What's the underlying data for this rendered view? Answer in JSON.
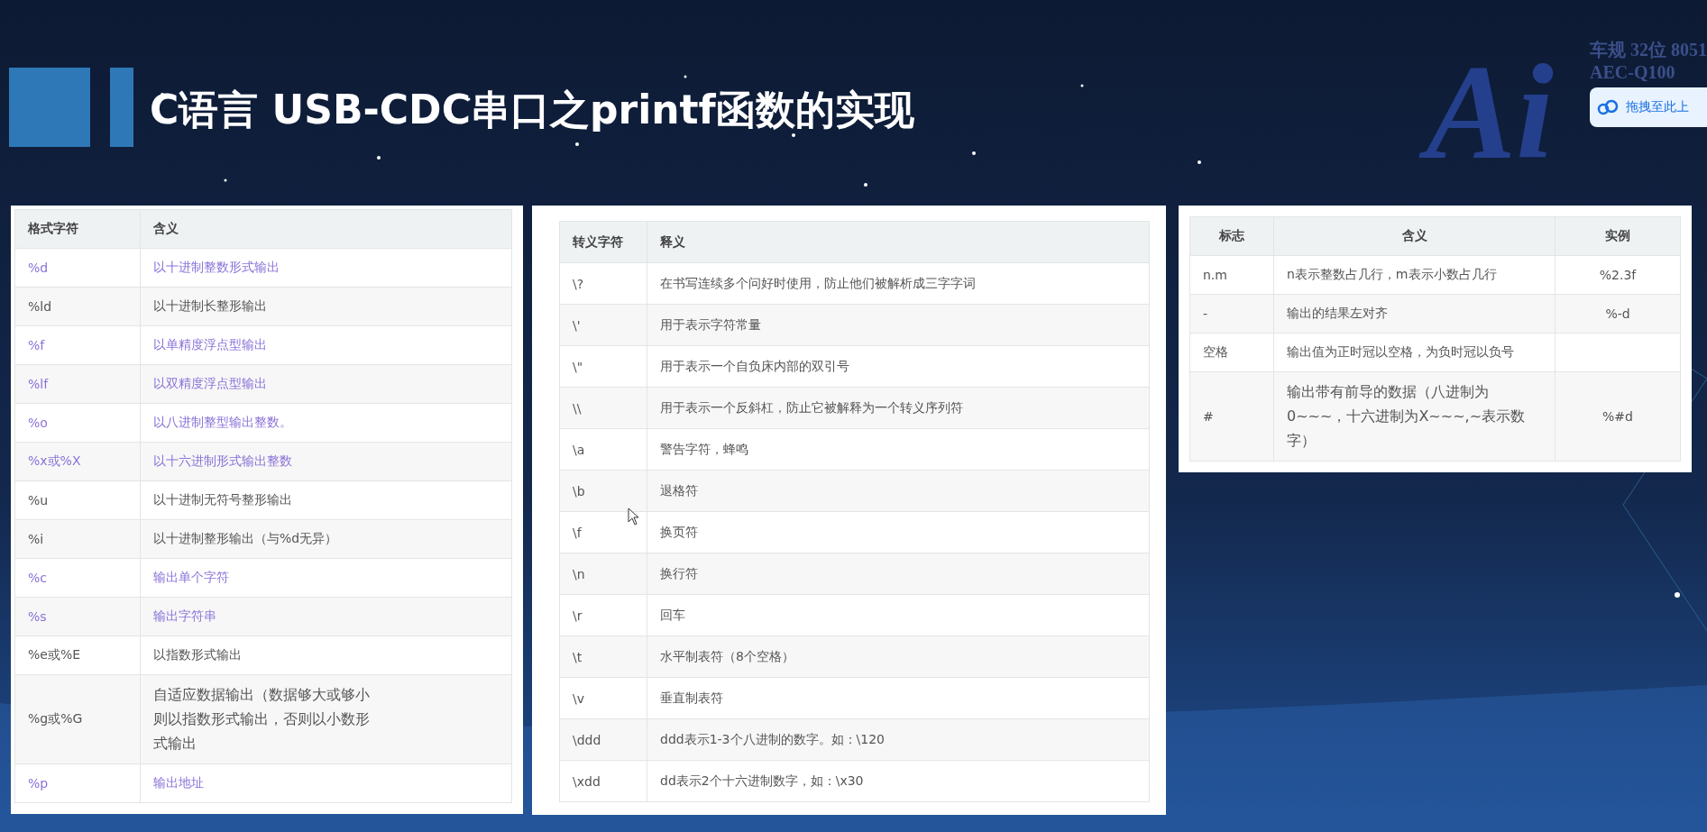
{
  "title": "C语言 USB-CDC串口之printf函数的实现",
  "logo": {
    "mark": "Ai",
    "lines": [
      "车规 32位 8051",
      "AEC-Q100"
    ]
  },
  "upload_button": {
    "label": "拖拽至此上"
  },
  "format_table": {
    "columns": [
      "格式字符",
      "含义"
    ],
    "rows": [
      {
        "cells": [
          "%d",
          "以十进制整数形式输出"
        ],
        "link": true
      },
      {
        "cells": [
          "%ld",
          "以十进制长整形输出"
        ],
        "link": false
      },
      {
        "cells": [
          "%f",
          "以单精度浮点型输出"
        ],
        "link": true
      },
      {
        "cells": [
          "%lf",
          "以双精度浮点型输出"
        ],
        "link": true
      },
      {
        "cells": [
          "%o",
          "以八进制整型输出整数。"
        ],
        "link": true
      },
      {
        "cells": [
          "%x或%X",
          "以十六进制形式输出整数"
        ],
        "link": true
      },
      {
        "cells": [
          "%u",
          "以十进制无符号整形输出"
        ],
        "link": false
      },
      {
        "cells": [
          "%i",
          "以十进制整形输出（与%d无异）"
        ],
        "link": false
      },
      {
        "cells": [
          "%c",
          "输出单个字符"
        ],
        "link": true
      },
      {
        "cells": [
          "%s",
          "输出字符串"
        ],
        "link": true
      },
      {
        "cells": [
          "%e或%E",
          "以指数形式输出"
        ],
        "link": false
      },
      {
        "cells": [
          "%g或%G",
          "自适应数据输出（数据够大或够小则以指数形式输出，否则以小数形式输出"
        ],
        "link": false
      },
      {
        "cells": [
          "%p",
          "输出地址"
        ],
        "link": true
      }
    ]
  },
  "escape_table": {
    "columns": [
      "转义字符",
      "释义"
    ],
    "rows": [
      [
        "\\?",
        "在书写连续多个问好时使用，防止他们被解析成三字字词"
      ],
      [
        "\\'",
        "用于表示字符常量"
      ],
      [
        "\\\"",
        "用于表示一个自负床内部的双引号"
      ],
      [
        "\\\\",
        "用于表示一个反斜杠，防止它被解释为一个转义序列符"
      ],
      [
        "\\a",
        "警告字符，蜂鸣"
      ],
      [
        "\\b",
        "退格符"
      ],
      [
        "\\f",
        "换页符"
      ],
      [
        "\\n",
        "换行符"
      ],
      [
        "\\r",
        "回车"
      ],
      [
        "\\t",
        "水平制表符（8个空格）"
      ],
      [
        "\\v",
        "垂直制表符"
      ],
      [
        "\\ddd",
        "ddd表示1-3个八进制的数字。如：\\120"
      ],
      [
        "\\xdd",
        "dd表示2个十六进制数字，如：\\x30"
      ]
    ]
  },
  "flag_table": {
    "columns": [
      "标志",
      "含义",
      "实例"
    ],
    "rows": [
      [
        "n.m",
        "n表示整数占几行，m表示小数占几行",
        "%2.3f"
      ],
      [
        "-",
        "输出的结果左对齐",
        "%-d"
      ],
      [
        "空格",
        "输出值为正时冠以空格，为负时冠以负号",
        null
      ],
      [
        "#",
        "输出带有前导的数据（八进制为0~~~，十六进制为X~~~,~表示数字）",
        "%#d"
      ]
    ]
  }
}
